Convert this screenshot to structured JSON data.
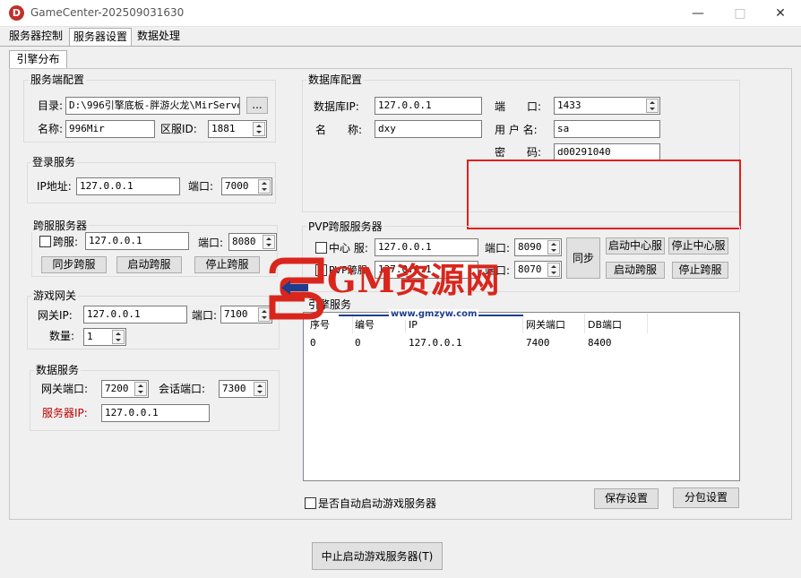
{
  "window": {
    "title": "GameCenter-202509031630",
    "icon_letter": "D"
  },
  "menu_tabs": [
    "服务器控制",
    "服务器设置",
    "数据处理"
  ],
  "sub_tab": "引擎分布",
  "server_config": {
    "title": "服务端配置",
    "dir_label": "目录:",
    "dir_value": "D:\\996引擎底板-胖游火龙\\MirServer",
    "browse": "...",
    "name_label": "名称:",
    "name_value": "996Mir",
    "zone_label": "区服ID:",
    "zone_value": "1881"
  },
  "login_service": {
    "title": "登录服务",
    "ip_label": "IP地址:",
    "ip_value": "127.0.0.1",
    "port_label": "端口:",
    "port_value": "7000"
  },
  "cross_server": {
    "title": "跨服服务器",
    "chk_label": "跨服:",
    "ip_value": "127.0.0.1",
    "port_label": "端口:",
    "port_value": "8080",
    "btn_sync": "同步跨服",
    "btn_start": "启动跨服",
    "btn_stop": "停止跨服"
  },
  "gateway": {
    "title": "游戏网关",
    "ip_label": "网关IP:",
    "ip_value": "127.0.0.1",
    "port_label": "端口:",
    "port_value": "7100",
    "count_label": "数量:",
    "count_value": "1"
  },
  "data_service": {
    "title": "数据服务",
    "gw_port_label": "网关端口:",
    "gw_port_value": "7200",
    "session_label": "会话端口:",
    "session_value": "7300",
    "server_ip_label": "服务器IP:",
    "server_ip_value": "127.0.0.1"
  },
  "database": {
    "title": "数据库配置",
    "ip_label": "数据库IP:",
    "ip_value": "127.0.0.1",
    "port_label": "端　　口:",
    "port_value": "1433",
    "name_label": "名　　称:",
    "name_value": "dxy",
    "user_label": "用 户 名:",
    "user_value": "sa",
    "pwd_label": "密　　码:",
    "pwd_value": "d00291040"
  },
  "pvp": {
    "title": "PVP跨服服务器",
    "center_label": "中心 服:",
    "center_ip": "127.0.0.1",
    "center_port_label": "端口:",
    "center_port": "8090",
    "pvp_label": "PVP跨服:",
    "pvp_ip": "127.0.0.1",
    "pvp_port_label": "端口:",
    "pvp_port": "8070",
    "btn_sync": "同步",
    "btn_start_center": "启动中心服",
    "btn_stop_center": "停止中心服",
    "btn_start_cross": "启动跨服",
    "btn_stop_cross": "停止跨服"
  },
  "engine_service": {
    "title": "引擎服务",
    "columns": [
      "序号",
      "编号",
      "IP",
      "网关端口",
      "DB端口"
    ],
    "rows": [
      [
        "0",
        "0",
        "127.0.0.1",
        "7400",
        "8400"
      ]
    ]
  },
  "footer": {
    "auto_start_label": "是否自动启动游戏服务器",
    "save_btn": "保存设置",
    "split_btn": "分包设置",
    "stop_btn": "中止启动游戏服务器(T)"
  },
  "watermark": {
    "brand": "GM资源网",
    "url": "www.gmzyw.com"
  },
  "colors": {
    "highlight_box": "#e02020",
    "accent_label": "#c00000",
    "brand_red": "#d9261c",
    "brand_blue": "#1e3d8f"
  }
}
